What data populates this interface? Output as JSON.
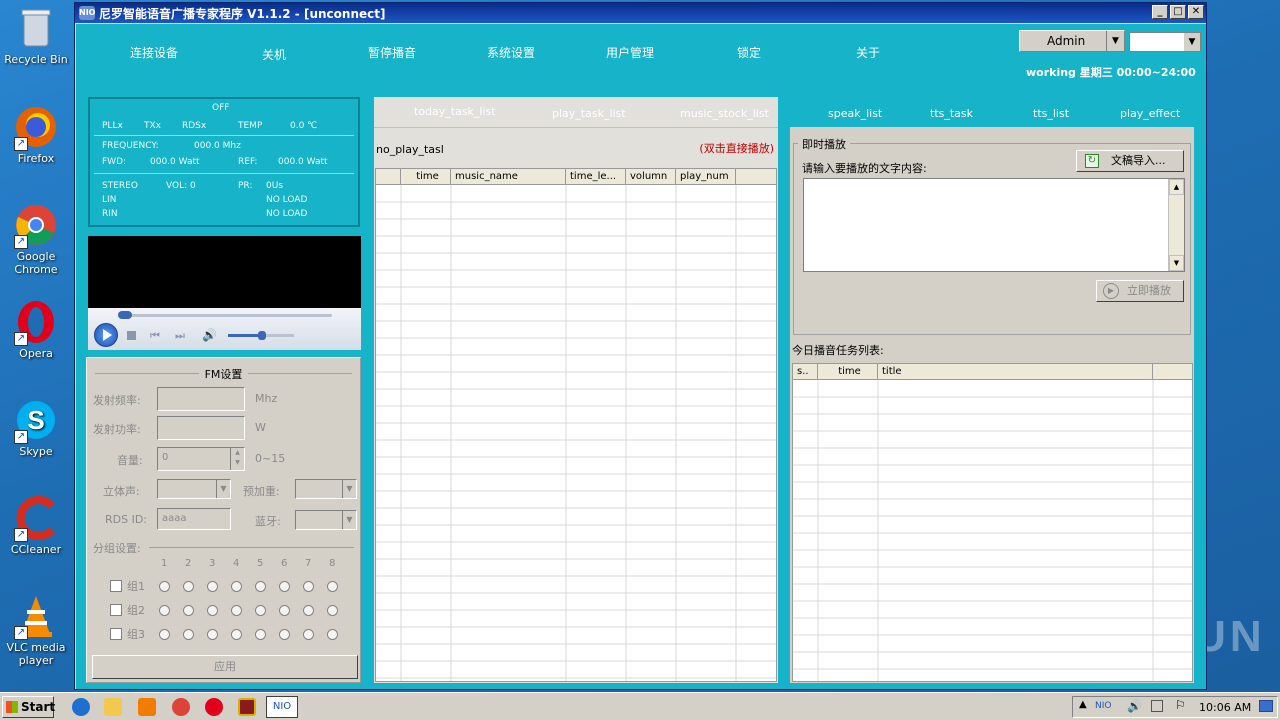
{
  "desktop": {
    "icons": [
      {
        "label": "Recycle Bin"
      },
      {
        "label": "Firefox"
      },
      {
        "label": "Google Chrome"
      },
      {
        "label": "Opera"
      },
      {
        "label": "Skype"
      },
      {
        "label": "CCleaner"
      },
      {
        "label": "VLC media player"
      }
    ]
  },
  "window": {
    "title": "尼罗智能语音广播专家程序 V1.1.2 - [unconnect]",
    "min": "_",
    "max": "□",
    "close": "✕"
  },
  "menu": [
    "连接设备",
    "关机",
    "暂停播音",
    "系统设置",
    "用户管理",
    "锁定",
    "关于"
  ],
  "user": {
    "name": "Admin",
    "status": "working  星期三 00:00~24:00"
  },
  "status_panel": {
    "off": "OFF",
    "pll": "PLLx",
    "tx": "TXx",
    "rds": "RDSx",
    "temp_label": "TEMP",
    "temp_value": "0.0 ℃",
    "freq_label": "FREQUENCY:",
    "freq_value": "000.0 Mhz",
    "fwd_label": "FWD:",
    "fwd_value": "000.0 Watt",
    "ref_label": "REF:",
    "ref_value": "000.0 Watt",
    "stereo": "STEREO",
    "vol": "VOL: 0",
    "pr": "PR:",
    "pr_value": "0Us",
    "lin": "LIN",
    "lin_value": "NO LOAD",
    "rin": "RIN",
    "rin_value": "NO LOAD"
  },
  "fm": {
    "title": "FM设置",
    "freq_label": "发射频率:",
    "freq_unit": "Mhz",
    "power_label": "发射功率:",
    "power_unit": "W",
    "volume_label": "音量:",
    "volume_value": "0",
    "volume_range": "0~15",
    "stereo_label": "立体声:",
    "preemph_label": "预加重:",
    "rds_label": "RDS ID:",
    "rds_value": "aaaa",
    "bt_label": "蓝牙:",
    "group_label": "分组设置:",
    "group_cols": [
      "1",
      "2",
      "3",
      "4",
      "5",
      "6",
      "7",
      "8"
    ],
    "groups": [
      "组1",
      "组2",
      "组3"
    ],
    "apply": "应用"
  },
  "middle": {
    "tabs": [
      "today_task_list",
      "play_task_list",
      "music_stock_list"
    ],
    "no_play": "no_play_tasl",
    "hint": "(双击直接播放)",
    "columns": [
      "",
      "time",
      "music_name",
      "time_le...",
      "volumn",
      "play_num"
    ]
  },
  "right": {
    "tabs": [
      "speak_list",
      "tts_task",
      "tts_list",
      "play_effect"
    ],
    "instant_title": "即时播放",
    "input_label": "请输入要播放的文字内容:",
    "import_btn": "文稿导入...",
    "play_btn": "立即播放",
    "today_title": "今日播音任务列表:",
    "columns": [
      "s..",
      "time",
      "title"
    ]
  },
  "taskbar": {
    "start": "Start",
    "clock": "10:06 AM",
    "app_label": "NIO"
  },
  "watermark": "ANY RUN"
}
